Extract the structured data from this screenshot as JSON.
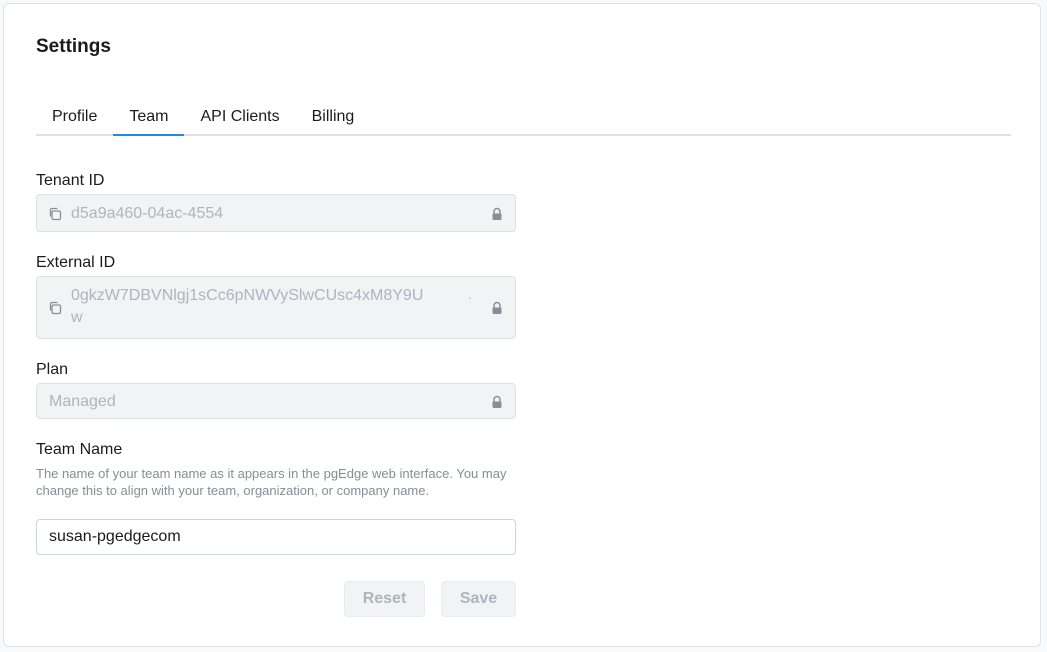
{
  "header": {
    "title": "Settings"
  },
  "tabs": [
    {
      "label": "Profile",
      "active": false
    },
    {
      "label": "Team",
      "active": true
    },
    {
      "label": "API Clients",
      "active": false
    },
    {
      "label": "Billing",
      "active": false
    }
  ],
  "form": {
    "tenant_id": {
      "label": "Tenant ID",
      "value": "d5a9a460-04ac-4554"
    },
    "external_id": {
      "label": "External ID",
      "value": "0gkzW7DBVNlgj1sCc6pNWVySlwCUsc4xM8Y9Uw"
    },
    "plan": {
      "label": "Plan",
      "value": "Managed"
    },
    "team_name": {
      "label": "Team Name",
      "description": "The name of your team name as it appears in the pgEdge web interface. You may change this to align with your team, organization, or company name.",
      "value": "susan-pgedgecom"
    }
  },
  "actions": {
    "reset_label": "Reset",
    "save_label": "Save"
  },
  "icons": {
    "copy": "copy-icon",
    "lock": "lock-icon"
  },
  "colors": {
    "accent": "#228be6",
    "disabled_text": "#adb5bd",
    "field_bg": "#f1f3f5"
  }
}
